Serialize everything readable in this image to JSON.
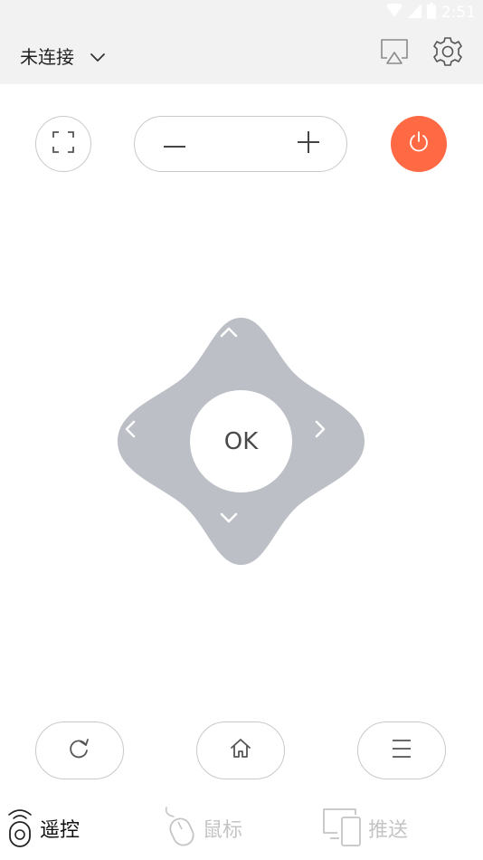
{
  "status_bar": {
    "time": "2:51",
    "icons": [
      "wifi-icon",
      "cell-signal-icon",
      "battery-icon"
    ]
  },
  "header": {
    "connection_label": "未连接",
    "icons": [
      "chevron-down-icon",
      "screen-cast-icon",
      "gear-icon"
    ]
  },
  "controls": {
    "ok_label": "OK",
    "icons": [
      "fullscreen-icon",
      "minus-icon",
      "plus-icon",
      "power-icon",
      "arrow-up-icon",
      "arrow-left-icon",
      "arrow-right-icon",
      "arrow-down-icon",
      "refresh-icon",
      "home-icon",
      "menu-icon"
    ]
  },
  "tabs": [
    {
      "label": "遥控",
      "icon": "remote-icon",
      "active": true
    },
    {
      "label": "鼠标",
      "icon": "mouse-icon",
      "active": false
    },
    {
      "label": "推送",
      "icon": "devices-icon",
      "active": false
    }
  ],
  "colors": {
    "header_bg": "#f2f2f2",
    "power": "#ff6a45",
    "dpad": "#bcbfc6",
    "inactive_tab": "#c4c4c4"
  }
}
